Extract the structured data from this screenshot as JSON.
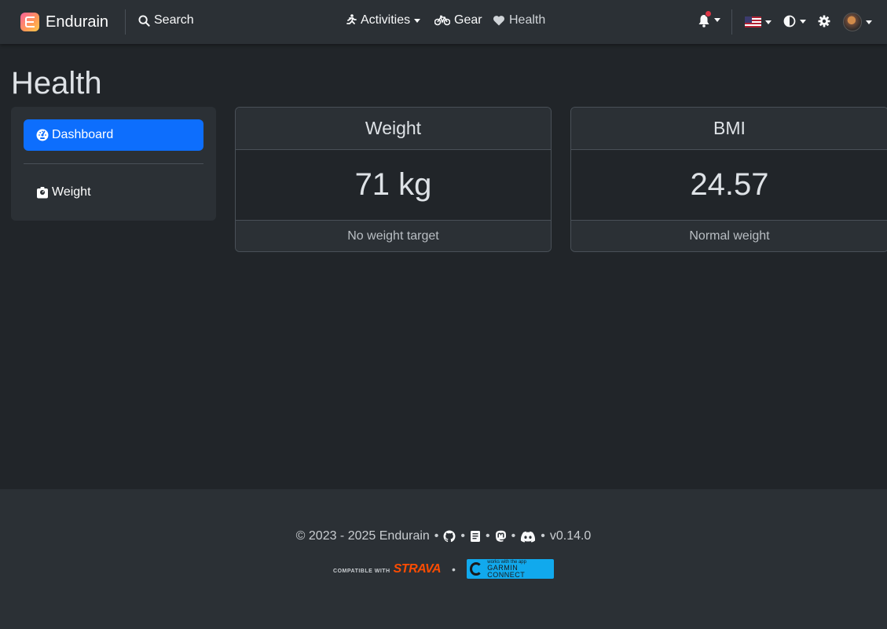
{
  "navbar": {
    "brand": "Endurain",
    "search_label": "Search",
    "activities_label": "Activities",
    "gear_label": "Gear",
    "health_label": "Health"
  },
  "page": {
    "title": "Health"
  },
  "sidebar": {
    "items": [
      {
        "label": "Dashboard",
        "active": true
      },
      {
        "label": "Weight",
        "active": false
      }
    ]
  },
  "cards": {
    "weight": {
      "title": "Weight",
      "value": "71 kg",
      "footer": "No weight target"
    },
    "bmi": {
      "title": "BMI",
      "value": "24.57",
      "footer": "Normal weight"
    }
  },
  "footer": {
    "copyright": "© 2023 - 2025 Endurain",
    "version": "v0.14.0",
    "strava_prefix": "COMPATIBLE WITH",
    "strava_brand": "STRAVA",
    "garmin_small": "works with the app",
    "garmin_big": "GARMIN CONNECT"
  },
  "colors": {
    "accent": "#0d6efd",
    "background": "#212529",
    "surface": "#2b3035",
    "notification": "#dc3545"
  },
  "icons": [
    "search-icon",
    "running-icon",
    "bike-icon",
    "heart-icon",
    "bell-icon",
    "flag-us-icon",
    "contrast-icon",
    "gear-icon",
    "avatar",
    "gauge-icon",
    "scale-icon",
    "github-icon",
    "book-icon",
    "mastodon-icon",
    "discord-icon"
  ]
}
